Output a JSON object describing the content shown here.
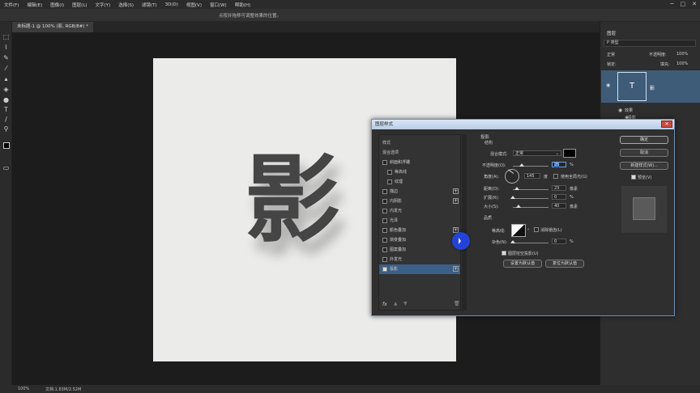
{
  "menu": {
    "items": [
      "文件(F)",
      "编辑(E)",
      "图像(I)",
      "图层(L)",
      "文字(Y)",
      "选择(S)",
      "滤镜(T)",
      "3D(D)",
      "视图(V)",
      "窗口(W)",
      "帮助(H)"
    ],
    "win_min": "─",
    "win_max": "□",
    "win_close": "✕"
  },
  "options_bar": {
    "hint": "点按并拖移可调整效果的位置。"
  },
  "document": {
    "tab_label": "未标题-1 @ 100% (影, RGB/8#) *",
    "glyph": "影"
  },
  "status": {
    "zoom": "100%",
    "doc_info": "文档:1.83M/2.52M"
  },
  "layers_panel": {
    "title": "图层",
    "filter_label": "P 类型",
    "blend_mode": "正常",
    "opacity_label": "不透明度:",
    "opacity_value": "100%",
    "lock_label": "锁定:",
    "fill_label": "填充:",
    "fill_value": "100%",
    "layer_thumb": "T",
    "layer_name": "影",
    "effects_label": "效果",
    "effect_item": "投影"
  },
  "dialog": {
    "title": "图层样式",
    "close": "✕",
    "list_header": "样式",
    "blend_options": "混合选项",
    "styles": [
      {
        "label": "斜面和浮雕",
        "checked": false,
        "plus": false
      },
      {
        "label": "等高线",
        "checked": false,
        "plus": false,
        "indent": true
      },
      {
        "label": "纹理",
        "checked": false,
        "plus": false,
        "indent": true
      },
      {
        "label": "描边",
        "checked": false,
        "plus": true
      },
      {
        "label": "内阴影",
        "checked": false,
        "plus": true
      },
      {
        "label": "内发光",
        "checked": false,
        "plus": false
      },
      {
        "label": "光泽",
        "checked": false,
        "plus": false
      },
      {
        "label": "颜色叠加",
        "checked": false,
        "plus": true
      },
      {
        "label": "渐变叠加",
        "checked": false,
        "plus": true
      },
      {
        "label": "图案叠加",
        "checked": false,
        "plus": false
      },
      {
        "label": "外发光",
        "checked": false,
        "plus": false
      },
      {
        "label": "投影",
        "checked": true,
        "plus": true,
        "active": true
      }
    ],
    "footer_fx": "fx",
    "section_title": "投影",
    "structure": "结构",
    "blend_mode_label": "混合模式:",
    "blend_mode_value": "正常",
    "shadow_color": "#000000",
    "opacity_label": "不透明度(O):",
    "opacity_value": "25",
    "angle_label": "角度(A):",
    "angle_value": "145",
    "degree": "度",
    "global_light": "使用全局光(G)",
    "distance_label": "距离(D):",
    "distance_value": "23",
    "spread_label": "扩展(R):",
    "spread_value": "0",
    "size_label": "大小(S):",
    "size_value": "40",
    "px": "像素",
    "pct": "%",
    "quality": "品质",
    "contour_label": "等高线:",
    "antialias": "消除锯齿(L)",
    "noise_label": "杂色(N):",
    "noise_value": "0",
    "knockout": "图层挖空投影(U)",
    "set_default": "设置为默认值",
    "reset_default": "复位为默认值",
    "ok": "确定",
    "cancel": "取消",
    "new_style": "新建样式(W)...",
    "preview": "预览(V)"
  }
}
